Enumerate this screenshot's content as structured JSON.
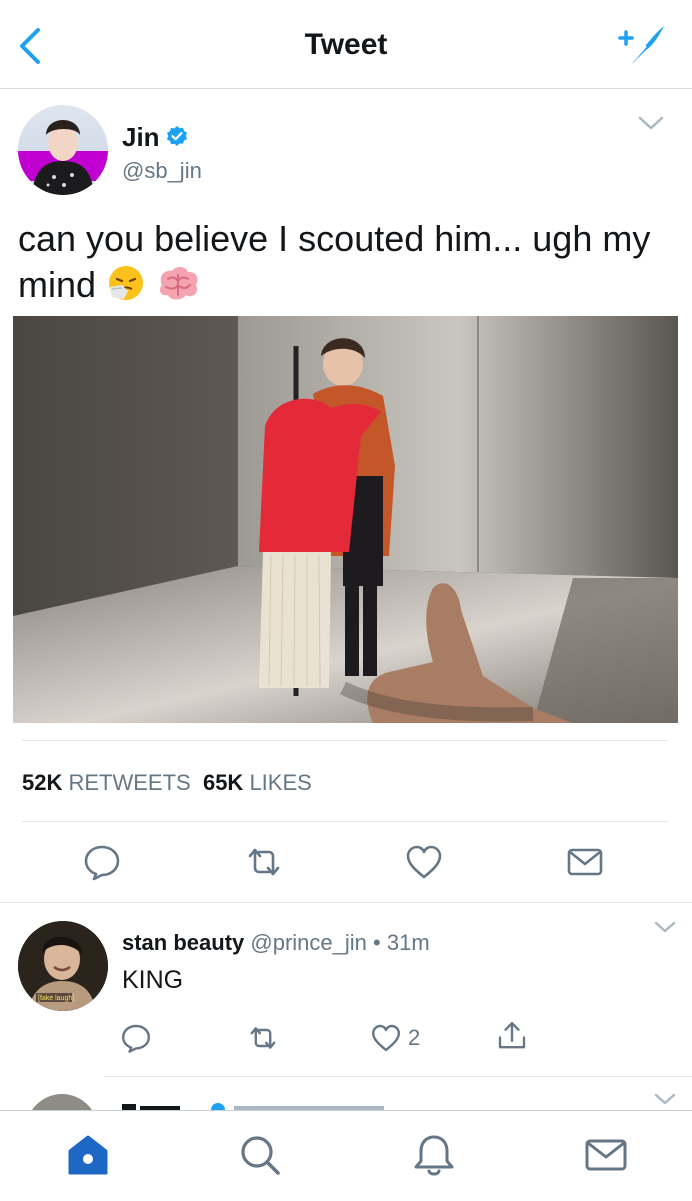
{
  "header": {
    "title": "Tweet",
    "back_icon": "chevron-left-icon",
    "compose_icon": "compose-feather-icon"
  },
  "colors": {
    "accent": "#1da1f2",
    "text": "#14171a",
    "secondary": "#657786",
    "divider": "#e1e8ed"
  },
  "tweet": {
    "author_name": "Jin",
    "handle": "@sb_jin",
    "verified": true,
    "text": "can you believe I scouted him... ugh my mind",
    "emojis": [
      "sneezing-face-emoji",
      "brain-emoji"
    ],
    "retweets": "52K",
    "retweets_label": "RETWEETS",
    "likes": "65K",
    "likes_label": "LIKES",
    "actions": [
      "reply-icon",
      "retweet-icon",
      "like-icon",
      "direct-message-icon"
    ]
  },
  "reply": {
    "author_name": "stan beauty",
    "handle": "@prince_jin",
    "separator": "•",
    "time": "31m",
    "text": "KING",
    "avatar_caption": "[fake laugh]",
    "like_count": "2",
    "actions": [
      "reply-icon",
      "retweet-icon",
      "like-icon",
      "share-icon"
    ]
  },
  "tabbar": {
    "items": [
      {
        "name": "home",
        "icon": "home-icon",
        "active": true
      },
      {
        "name": "search",
        "icon": "search-icon",
        "active": false
      },
      {
        "name": "notifications",
        "icon": "bell-icon",
        "active": false
      },
      {
        "name": "messages",
        "icon": "mail-icon",
        "active": false
      }
    ]
  }
}
